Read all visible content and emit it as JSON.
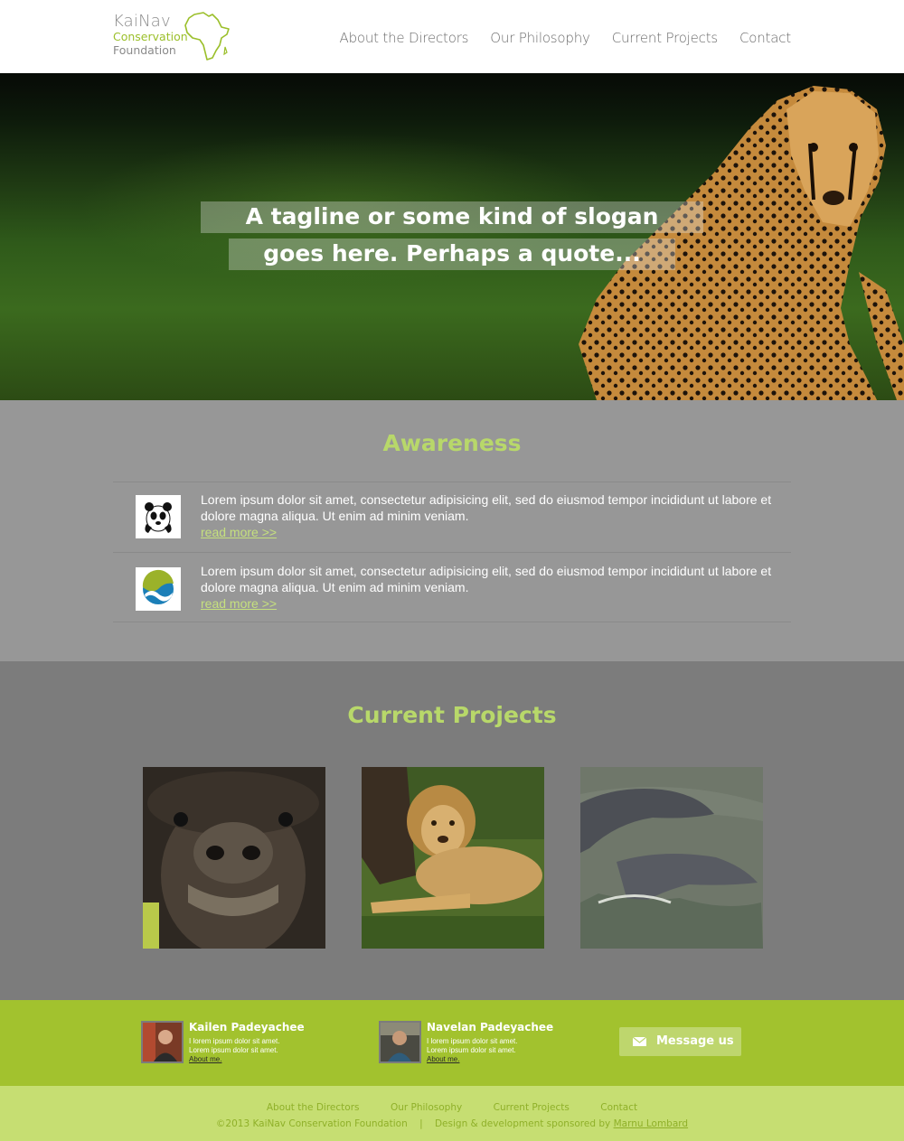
{
  "header": {
    "logo": {
      "line1": "KaiNav",
      "line2": "Conservation",
      "line3": "Foundation"
    },
    "nav": [
      "About the Directors",
      "Our Philosophy",
      "Current Projects",
      "Contact"
    ]
  },
  "hero": {
    "tagline_line1": "A tagline or some kind of slogan",
    "tagline_line2": "goes here. Perhaps a quote..."
  },
  "awareness": {
    "title": "Awareness",
    "items": [
      {
        "icon": "panda-logo-icon",
        "text": "Lorem ipsum dolor sit amet, consectetur adipisicing elit, sed do eiusmod tempor incididunt ut labore et dolore magna aliqua. Ut enim ad minim veniam.",
        "link": "read more >>"
      },
      {
        "icon": "wave-logo-icon",
        "text": "Lorem ipsum dolor sit amet, consectetur adipisicing elit, sed do eiusmod tempor incididunt ut labore et dolore magna aliqua. Ut enim ad minim veniam.",
        "link": "read more >>"
      }
    ]
  },
  "projects": {
    "title": "Current Projects",
    "images": [
      "buffalo-photo",
      "lion-photo",
      "dolphins-photo"
    ]
  },
  "directors": [
    {
      "name": "Kailen Padeyachee",
      "line1": "I lorem ipsum dolor sit amet.",
      "line2": "Lorem ipsum dolor sit amet.",
      "about": "About me."
    },
    {
      "name": "Navelan Padeyachee",
      "line1": "I lorem ipsum dolor sit amet.",
      "line2": "Lorem ipsum dolor sit amet.",
      "about": "About me."
    }
  ],
  "message_button": "Message us",
  "footer": {
    "nav": [
      "About the Directors",
      "Our Philosophy",
      "Current Projects",
      "Contact"
    ],
    "copyright": "©2013 KaiNav Conservation Foundation",
    "separator": "|",
    "credit_prefix": "Design & development sponsored by",
    "credit_name": "Marnu Lombard"
  },
  "colors": {
    "accent": "#a2c22e",
    "accent_light": "#c6de72",
    "title_green": "#b8d86a",
    "awareness_bg": "#979797",
    "projects_bg": "#7c7c7c"
  }
}
